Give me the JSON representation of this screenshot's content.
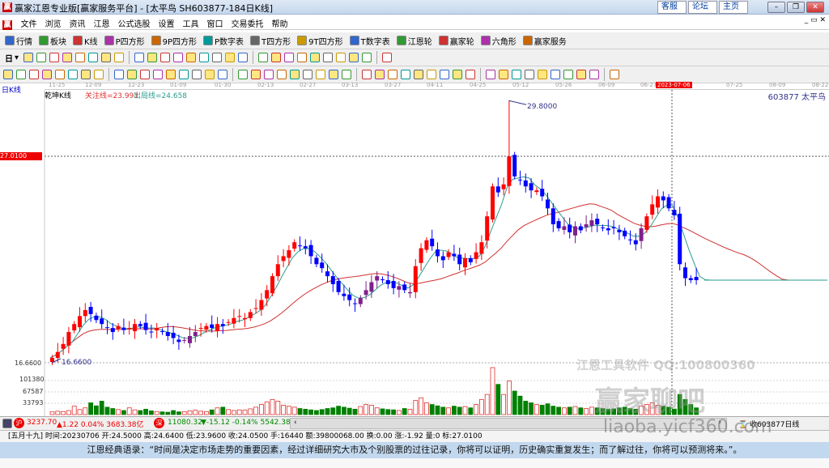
{
  "window": {
    "title": "赢家江恩专业版[赢家服务平台] - [太平鸟  SH603877-184日K线]",
    "links": [
      "客服",
      "论坛",
      "主页"
    ]
  },
  "menu": [
    "文件",
    "浏览",
    "资讯",
    "江恩",
    "公式选股",
    "设置",
    "工具",
    "窗口",
    "交易委托",
    "帮助"
  ],
  "toolbar1": [
    {
      "label": "行情",
      "icon": "quotes-icon"
    },
    {
      "label": "板块",
      "icon": "sector-icon"
    },
    {
      "label": "K线",
      "icon": "kline-icon"
    },
    {
      "label": "P四方形",
      "icon": "p-square-icon"
    },
    {
      "label": "9P四方形",
      "icon": "9p-square-icon"
    },
    {
      "label": "P数字表",
      "icon": "p-number-table-icon"
    },
    {
      "label": "T四方形",
      "icon": "t-square-icon"
    },
    {
      "label": "9T四方形",
      "icon": "9t-square-icon"
    },
    {
      "label": "T数字表",
      "icon": "t-number-table-icon"
    },
    {
      "label": "江恩轮",
      "icon": "gann-wheel-icon"
    },
    {
      "label": "赢家轮",
      "icon": "winner-wheel-icon"
    },
    {
      "label": "六角形",
      "icon": "hexagon-icon"
    },
    {
      "label": "赢家服务",
      "icon": "dollar-icon"
    }
  ],
  "toolbar2": {
    "period": "日",
    "icons": [
      "chain-icon",
      "calendar-icon",
      "chart-up-icon",
      "chart-down-icon",
      "candle-icon",
      "percent-icon",
      "flag-icon",
      "first-icon",
      "last-icon",
      "left-icon",
      "right-icon",
      "zoom-in-icon",
      "zoom-out-icon",
      "expand-icon",
      "shrink-icon",
      "up-icon",
      "down-icon",
      "hand-icon",
      "crosshair-icon",
      "line-tool-icon",
      "section-icon",
      "layout-icon",
      "calc-icon",
      "calculator-icon",
      "book-icon",
      "save-icon",
      "truck-icon"
    ]
  },
  "toolbar3": {
    "icons": [
      "pen-icon",
      "grid-icon",
      "gold-icon",
      "gold2-icon",
      "fan-icon",
      "arc-icon",
      "triangle-icon",
      "circle-icon",
      "lines-icon",
      "n2-icon",
      "angle-icon",
      "target-icon",
      "star-icon",
      "box-icon",
      "wave-icon",
      "time-icon",
      "price-icon",
      "square-grid-icon",
      "split-icon",
      "window-icon",
      "fan-lines-icon",
      "pattern-icon",
      "pattern2-icon",
      "angle2-icon",
      "v-icon",
      "table-icon",
      "table2-icon",
      "lines2-icon",
      "bar-icon",
      "pct-line-icon",
      "percent-icon",
      "pct2-icon",
      "gold-coin-icon",
      "gold-line-icon",
      "arrow-line-icon",
      "line-a-icon",
      "line-b-icon",
      "line-c-icon",
      "line-d-icon",
      "line-e-icon",
      "line-f-icon",
      "line-g-icon",
      "line-h-icon",
      "taichi-icon",
      "infinity-icon"
    ]
  },
  "chart": {
    "period_label": "日K线",
    "indicator": "乾坤K线",
    "attention_line": "关注线=23.991",
    "exit_line": "出局线=24.658",
    "stock_label": "603877  太平鸟",
    "high_label": "29.8000",
    "low_label": "16.6600",
    "crosshair_price": "27.0100",
    "low_axis": "16.6600",
    "vol_ticks": [
      "101380",
      "67587",
      "33793"
    ],
    "dates": [
      "11-25",
      "12-09",
      "12-23",
      "01-09",
      "01-30",
      "02-13",
      "02-27",
      "03-13",
      "03-27",
      "04-11",
      "04-25",
      "05-12",
      "05-26",
      "06-09",
      "06-27",
      "2023-07-06",
      "07-25",
      "08-09",
      "08-22"
    ],
    "watermark1": "江恩工具软件  QQ:100800360",
    "watermark2": "赢家聊吧",
    "watermark3": "liaoba.yicf360.com",
    "colors": {
      "up": "#ff0000",
      "down": "#0000ff",
      "ma_short": "#2a9d8f",
      "ma_long": "#d03030",
      "vol_up": "#e03030",
      "vol_down": "#008000"
    }
  },
  "chart_data": {
    "type": "candlestick",
    "y_range": [
      16.66,
      29.8
    ],
    "closes": [
      16.9,
      17.2,
      17.6,
      18.2,
      18.6,
      19.0,
      19.3,
      19.1,
      18.8,
      18.6,
      18.4,
      18.2,
      18.5,
      18.3,
      18.4,
      18.6,
      18.5,
      18.3,
      18.2,
      18.4,
      18.2,
      18.0,
      17.9,
      17.7,
      17.8,
      18.0,
      18.2,
      18.4,
      18.5,
      18.4,
      18.6,
      18.5,
      18.7,
      18.9,
      19.0,
      18.9,
      19.2,
      19.4,
      19.8,
      20.3,
      21.0,
      21.6,
      22.0,
      22.3,
      22.7,
      22.5,
      22.4,
      22.0,
      21.6,
      21.4,
      21.0,
      20.6,
      20.2,
      20.0,
      19.8,
      19.6,
      19.9,
      20.3,
      20.7,
      21.0,
      20.8,
      20.6,
      20.4,
      20.5,
      20.3,
      20.2,
      21.5,
      22.4,
      22.8,
      22.5,
      22.0,
      21.8,
      22.2,
      22.0,
      21.6,
      21.9,
      21.7,
      22.2,
      22.7,
      24.0,
      25.5,
      25.2,
      25.6,
      27.0,
      26.0,
      25.8,
      25.5,
      25.3,
      25.3,
      25.0,
      24.4,
      23.6,
      23.4,
      23.5,
      23.2,
      23.5,
      23.3,
      23.6,
      23.8,
      23.6,
      23.4,
      23.3,
      23.4,
      23.2,
      23.0,
      22.8,
      22.6,
      23.4,
      24.0,
      24.6,
      25.0,
      24.8,
      24.4,
      24.05,
      21.6,
      20.9,
      20.8,
      20.8
    ],
    "volumes": [
      8000,
      10000,
      9000,
      12000,
      25000,
      15000,
      20000,
      35000,
      26000,
      40000,
      22000,
      18000,
      15000,
      12000,
      20000,
      14000,
      12000,
      16000,
      11000,
      9000,
      8000,
      7000,
      12000,
      8000,
      9000,
      11000,
      13000,
      10000,
      9000,
      14000,
      20000,
      22000,
      15000,
      12000,
      14000,
      13000,
      17000,
      22000,
      30000,
      38000,
      45000,
      40000,
      28000,
      25000,
      22000,
      18000,
      16000,
      14000,
      12000,
      15000,
      18000,
      20000,
      25000,
      22000,
      19000,
      16000,
      24000,
      30000,
      28000,
      20000,
      17000,
      15000,
      14000,
      12000,
      18000,
      16000,
      42000,
      50000,
      35000,
      30000,
      26000,
      22000,
      20000,
      25000,
      22000,
      24000,
      20000,
      30000,
      45000,
      60000,
      140000,
      90000,
      60000,
      100000,
      70000,
      55000,
      40000,
      35000,
      30000,
      28000,
      32000,
      25000,
      22000,
      20000,
      22000,
      24000,
      20000,
      18000,
      22000,
      20000,
      18000,
      16000,
      17000,
      20000,
      22000,
      18000,
      16000,
      25000,
      30000,
      35000,
      28000,
      25000,
      22000,
      16440,
      60000,
      45000,
      30000,
      20000
    ]
  },
  "status": {
    "sh_index": "3237.70",
    "sh_change": "▲1.22 0.04% 3683.38亿",
    "sz_index": "11080.32",
    "sz_change": "▼-15.12 -0.14% 5542.38",
    "right": "收603877日线"
  },
  "info": "[五月十九] 时间:20230706 开:24.5000 高:24.6400 低:23.9600 收:24.0500 手:16440 额:39800068.00 换:0.00 涨:-1.92 量:0 标:27.0100",
  "quote": "江恩经典语录：“时间是决定市场走势的重要因素，经过详细研究大市及个别股票的过往记录，你将可以证明，历史确实重复发生；而了解过往，你将可以预测将来。”。"
}
